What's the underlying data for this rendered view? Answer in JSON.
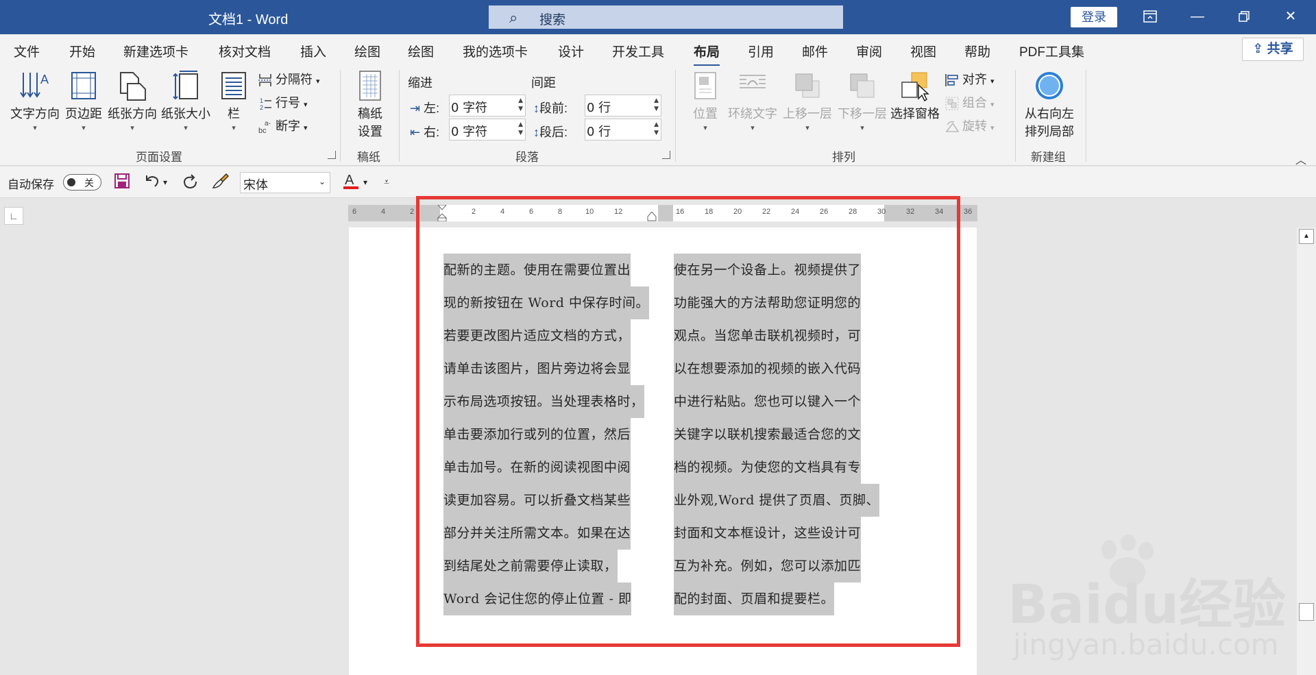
{
  "titlebar": {
    "title": "文档1  -  Word",
    "search_placeholder": "搜索",
    "login": "登录"
  },
  "menu": {
    "tabs": [
      "文件",
      "开始",
      "新建选项卡",
      "核对文档",
      "插入",
      "绘图",
      "绘图",
      "我的选项卡",
      "设计",
      "开发工具",
      "布局",
      "引用",
      "邮件",
      "审阅",
      "视图",
      "帮助",
      "PDF工具集"
    ],
    "active_tab": "布局",
    "share": "共享"
  },
  "ribbon": {
    "page_setup": {
      "label": "页面设置",
      "text_direction": "文字方向",
      "margins": "页边距",
      "orientation": "纸张方向",
      "size": "纸张大小",
      "columns": "栏",
      "breaks": "分隔符",
      "line_numbers": "行号",
      "hyphenation": "断字"
    },
    "manuscript": {
      "label": "稿纸",
      "setup_line1": "稿纸",
      "setup_line2": "设置"
    },
    "paragraph": {
      "label": "段落",
      "indent_title": "缩进",
      "spacing_title": "间距",
      "left_label": "左:",
      "left_value": "0 字符",
      "right_label": "右:",
      "right_value": "0 字符",
      "before_label": "段前:",
      "before_value": "0 行",
      "after_label": "段后:",
      "after_value": "0 行"
    },
    "arrange": {
      "label": "排列",
      "position": "位置",
      "wrap_text": "环绕文字",
      "bring_forward": "上移一层",
      "send_backward": "下移一层",
      "selection_pane": "选择窗格",
      "align": "对齐",
      "group": "组合",
      "rotate": "旋转"
    },
    "new_group": {
      "label": "新建组",
      "rtl_line1": "从右向左",
      "rtl_line2": "排列局部"
    }
  },
  "qat": {
    "autosave": "自动保存",
    "toggle_state": "关",
    "font": "宋体"
  },
  "ruler": {
    "ticks": [
      "6",
      "4",
      "2",
      "2",
      "4",
      "6",
      "8",
      "10",
      "12",
      "16",
      "18",
      "20",
      "22",
      "24",
      "26",
      "28",
      "30",
      "32",
      "34",
      "36"
    ]
  },
  "document": {
    "column1": [
      "配新的主题。使用在需要位置出",
      "现的新按钮在 Word 中保存时间。",
      "若要更改图片适应文档的方式，",
      "请单击该图片，图片旁边将会显",
      "示布局选项按钮。当处理表格时，",
      "单击要添加行或列的位置，然后",
      "单击加号。在新的阅读视图中阅",
      "读更加容易。可以折叠文档某些",
      "部分并关注所需文本。如果在达",
      "到结尾处之前需要停止读取，",
      "Word 会记住您的停止位置 - 即"
    ],
    "column2": [
      "使在另一个设备上。视频提供了",
      "功能强大的方法帮助您证明您的",
      "观点。当您单击联机视频时，可",
      "以在想要添加的视频的嵌入代码",
      "中进行粘贴。您也可以键入一个",
      "关键字以联机搜索最适合您的文",
      "档的视频。为使您的文档具有专",
      "业外观,Word 提供了页眉、页脚、",
      "封面和文本框设计，这些设计可",
      "互为补充。例如，您可以添加匹",
      "配的封面、页眉和提要栏。"
    ]
  },
  "watermark": {
    "brand": "Baidu经验",
    "site": "jingyan.baidu.com"
  }
}
